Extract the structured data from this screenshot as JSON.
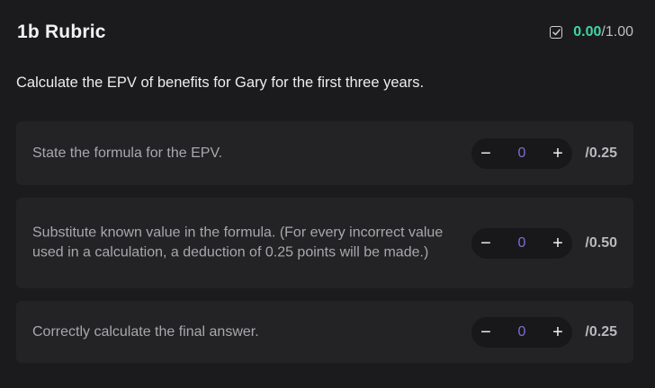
{
  "header": {
    "title": "1b Rubric",
    "score_earned": "0.00",
    "score_separator": "/",
    "score_total": "1.00"
  },
  "question": "Calculate the EPV of benefits for Gary for the first three years.",
  "criteria": [
    {
      "text": "State the formula for the EPV.",
      "value": "0",
      "max": "/0.25"
    },
    {
      "text": "Substitute known value in the formula. (For every incorrect value used in a calculation, a deduction of 0.25 points will be made.)",
      "value": "0",
      "max": "/0.50"
    },
    {
      "text": "Correctly calculate the final answer.",
      "value": "0",
      "max": "/0.25"
    }
  ],
  "controls": {
    "decrement_label": "−",
    "increment_label": "+"
  },
  "icons": {
    "score": "checkbox-checked-icon"
  },
  "colors": {
    "score_earned": "#3fd6a0",
    "stepper_value": "#7b6fd0"
  }
}
